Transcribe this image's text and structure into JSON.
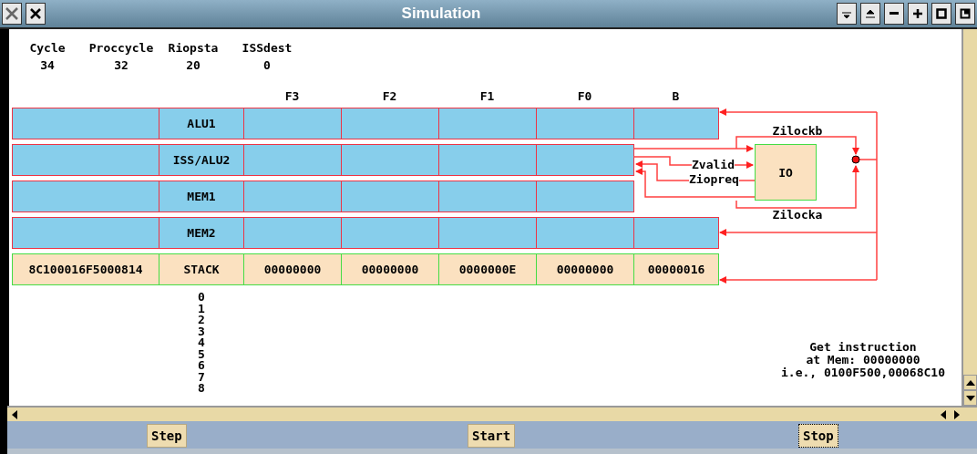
{
  "window": {
    "title": "Simulation"
  },
  "counters": [
    {
      "label": "Cycle",
      "value": "34"
    },
    {
      "label": "Proccycle",
      "value": "32"
    },
    {
      "label": "Riopsta",
      "value": "20"
    },
    {
      "label": "ISSdest",
      "value": "0"
    }
  ],
  "columns": [
    "F3",
    "F2",
    "F1",
    "F0",
    "B"
  ],
  "rows": [
    {
      "kind": "unit",
      "name": "ALU1",
      "has_b": true
    },
    {
      "kind": "unit",
      "name": "ISS/ALU2",
      "has_b": false
    },
    {
      "kind": "unit",
      "name": "MEM1",
      "has_b": false
    },
    {
      "kind": "unit",
      "name": "MEM2",
      "has_b": true
    },
    {
      "kind": "stack",
      "name": "STACK",
      "address": "8C100016F5000814",
      "values": [
        "00000000",
        "00000000",
        "0000000E",
        "00000000",
        "00000016"
      ],
      "has_b": true
    }
  ],
  "io": {
    "label": "IO",
    "lock_top": "Zilockb",
    "valid": "Zvalid",
    "request": "Ziopreq",
    "lock_bottom": "Zilocka"
  },
  "stack_indices": [
    "0",
    "1",
    "2",
    "3",
    "4",
    "5",
    "6",
    "7",
    "8"
  ],
  "message": [
    "Get instruction",
    "at Mem: 00000000",
    "i.e., 0100F500,00068C10"
  ],
  "buttons": [
    {
      "label": "Step",
      "focused": false
    },
    {
      "label": "Start",
      "focused": false
    },
    {
      "label": "Stop",
      "focused": true
    }
  ]
}
